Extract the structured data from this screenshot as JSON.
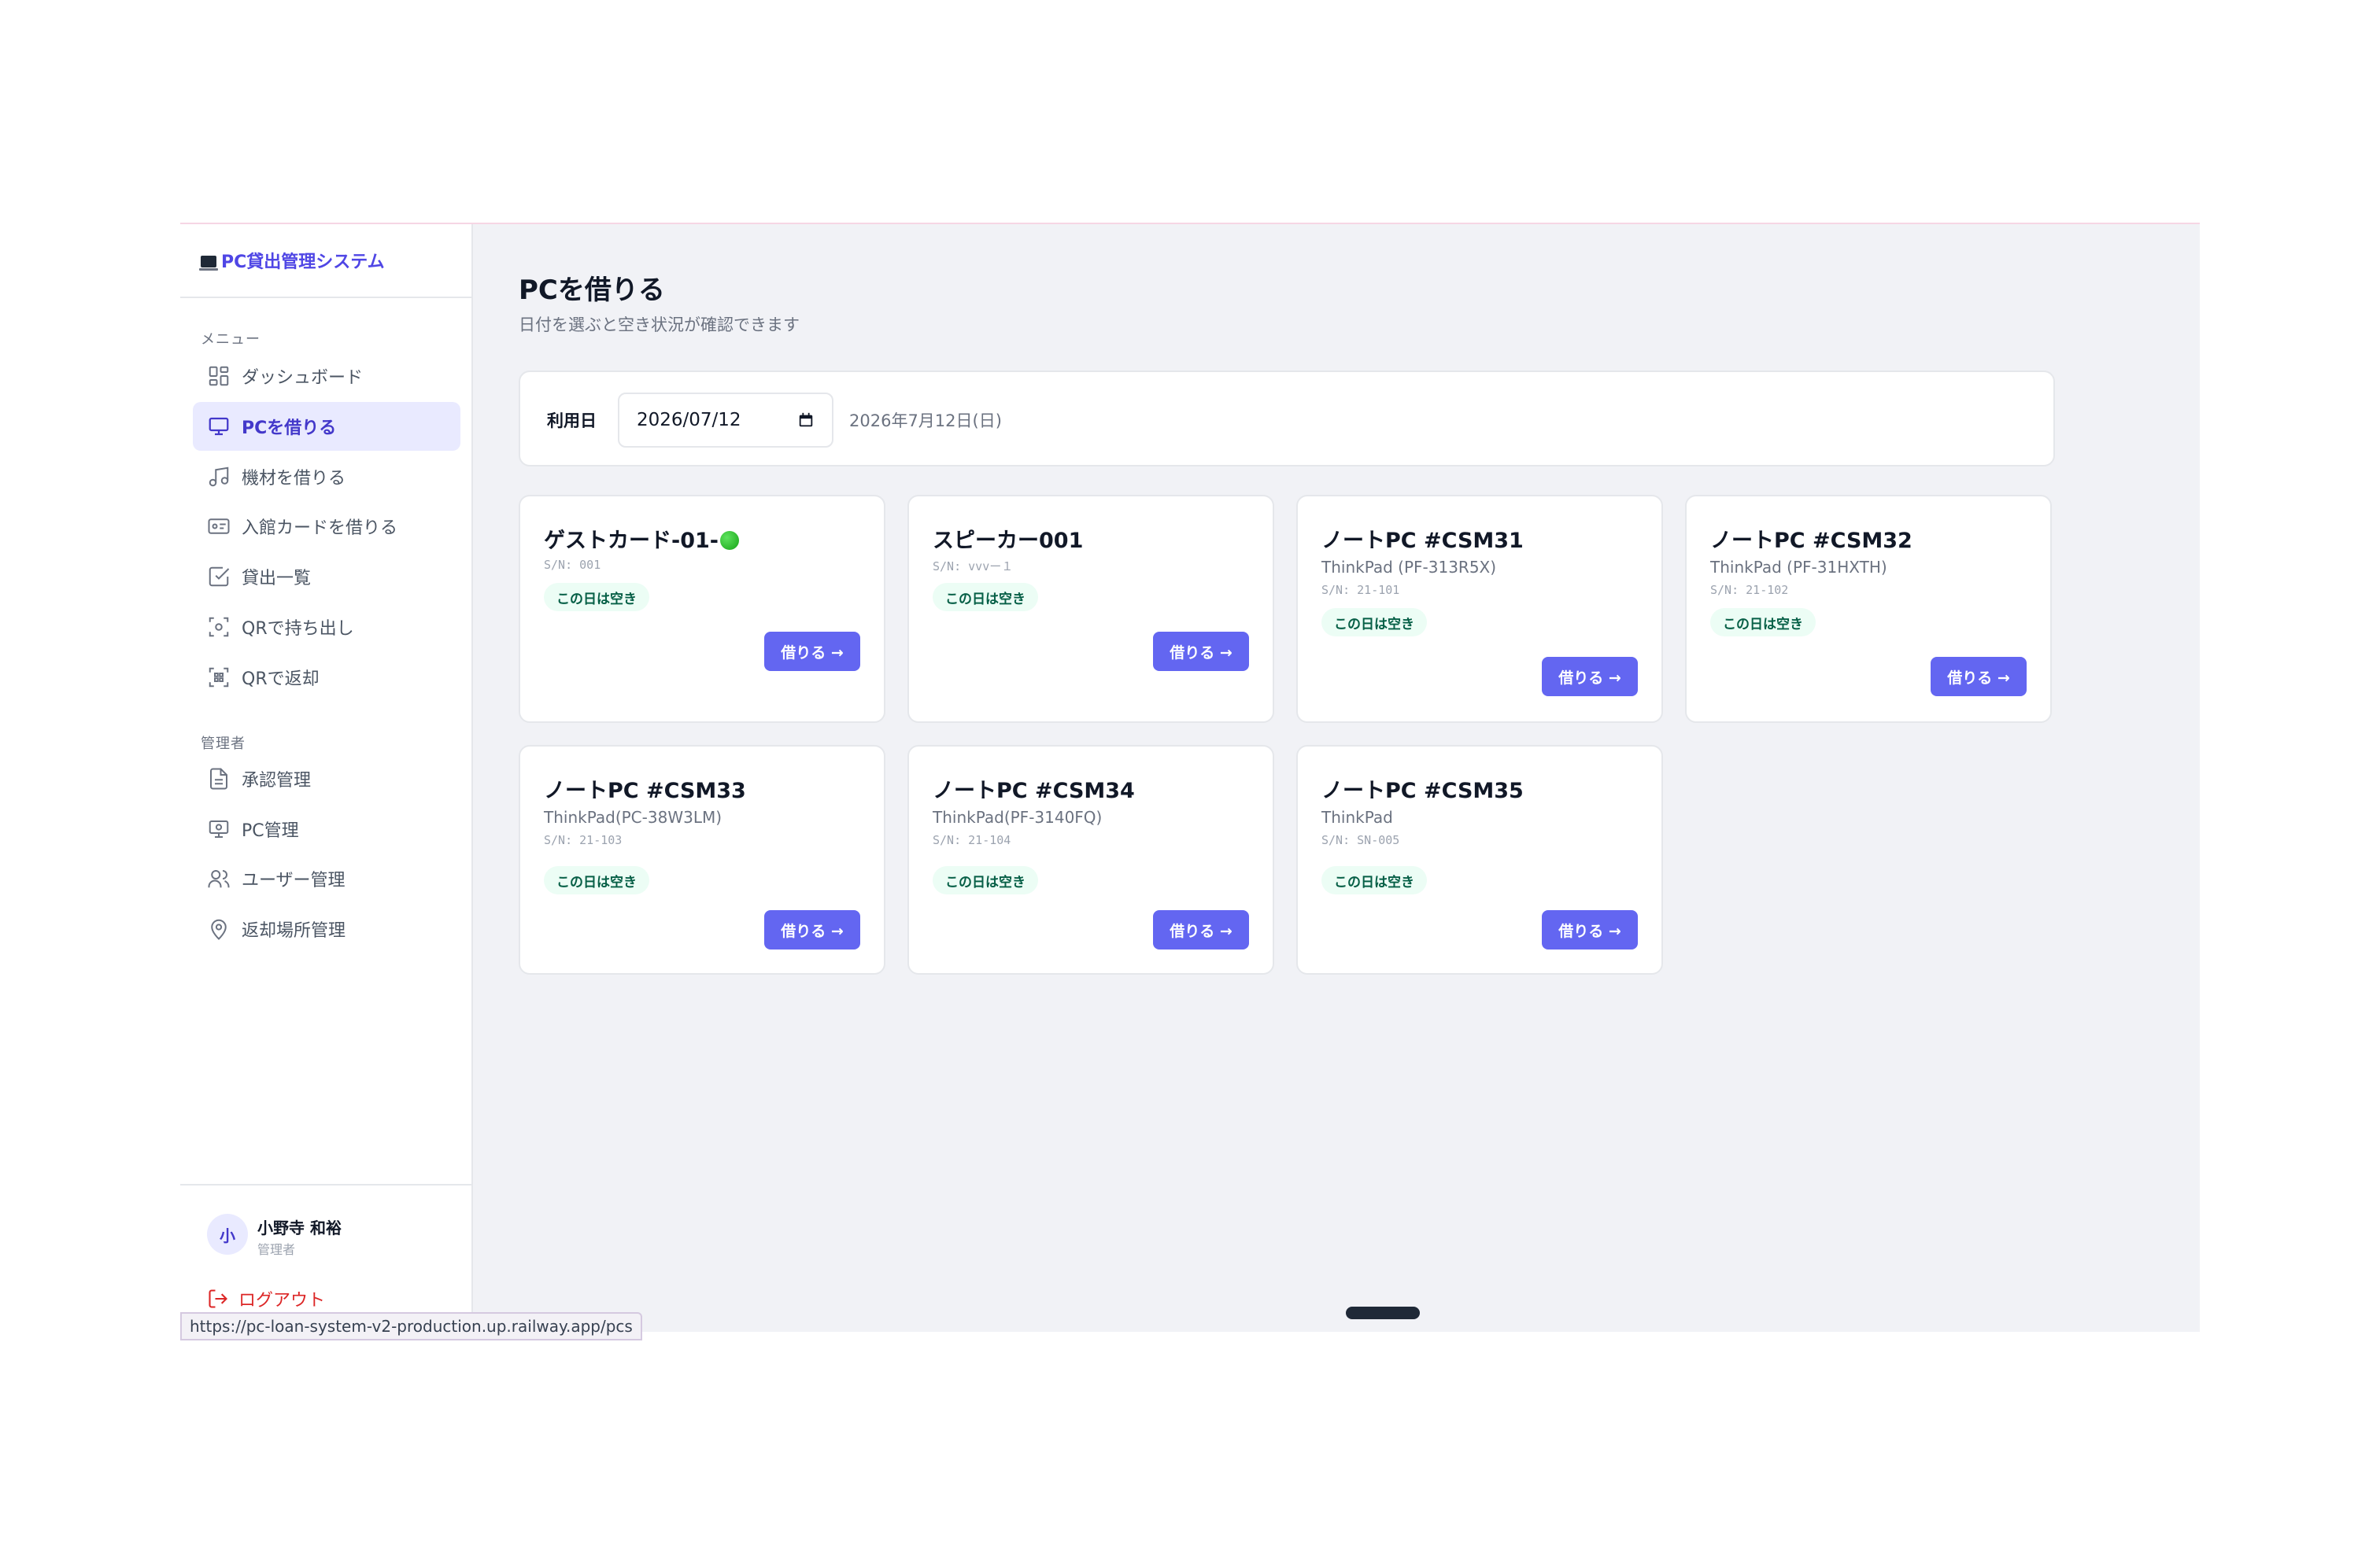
{
  "brand": {
    "title": "PC貸出管理システム"
  },
  "sidebar": {
    "menu_label": "メニュー",
    "menu_items": [
      {
        "label": "ダッシュボード",
        "icon": "dashboard-icon",
        "active": false
      },
      {
        "label": "PCを借りる",
        "icon": "monitor-icon",
        "active": true
      },
      {
        "label": "機材を借りる",
        "icon": "music-note-icon",
        "active": false
      },
      {
        "label": "入館カードを借りる",
        "icon": "id-card-icon",
        "active": false
      },
      {
        "label": "貸出一覧",
        "icon": "checkbox-icon",
        "active": false
      },
      {
        "label": "QRで持ち出し",
        "icon": "qr-scan-icon",
        "active": false
      },
      {
        "label": "QRで返却",
        "icon": "qr-return-icon",
        "active": false
      }
    ],
    "admin_label": "管理者",
    "admin_items": [
      {
        "label": "承認管理",
        "icon": "document-icon"
      },
      {
        "label": "PC管理",
        "icon": "pc-settings-icon"
      },
      {
        "label": "ユーザー管理",
        "icon": "users-icon"
      },
      {
        "label": "返却場所管理",
        "icon": "location-pin-icon"
      }
    ],
    "user": {
      "avatar": "小",
      "name": "小野寺 和裕",
      "role": "管理者"
    },
    "logout_label": "ログアウト"
  },
  "main": {
    "title": "PCを借りる",
    "subtitle": "日付を選ぶと空き状況が確認できます",
    "date_label": "利用日",
    "date_value": "2026/07/12",
    "date_human": "2026年7月12日(日)"
  },
  "pcs": [
    {
      "name": "ゲストカード-01-",
      "model": "",
      "serial": "S/N: 001",
      "status": "この日は空き",
      "button": "借りる →",
      "has_dot": true
    },
    {
      "name": "スピーカー001",
      "model": "",
      "serial": "S/N: vvvー１",
      "status": "この日は空き",
      "button": "借りる →"
    },
    {
      "name": "ノートPC #CSM31",
      "model": "ThinkPad (PF-313R5X)",
      "serial": "S/N: 21-101",
      "status": "この日は空き",
      "button": "借りる →"
    },
    {
      "name": "ノートPC #CSM32",
      "model": "ThinkPad (PF-31HXTH)",
      "serial": "S/N: 21-102",
      "status": "この日は空き",
      "button": "借りる →"
    },
    {
      "name": "ノートPC #CSM33",
      "model": "ThinkPad(PC-38W3LM)",
      "serial": "S/N: 21-103",
      "status": "この日は空き",
      "button": "借りる →"
    },
    {
      "name": "ノートPC #CSM34",
      "model": "ThinkPad(PF-3140FQ)",
      "serial": "S/N: 21-104",
      "status": "この日は空き",
      "button": "借りる →"
    },
    {
      "name": "ノートPC #CSM35",
      "model": "ThinkPad",
      "serial": "S/N: SN-005",
      "status": "この日は空き",
      "button": "借りる →"
    }
  ],
  "status_bar": {
    "url": "https://pc-loan-system-v2-production.up.railway.app/pcs"
  },
  "colors": {
    "accent": "#6366f1",
    "active_bg": "#e9eaff",
    "badge_bg": "#ecfdf5",
    "badge_text": "#065f46",
    "logout": "#dc2626"
  }
}
